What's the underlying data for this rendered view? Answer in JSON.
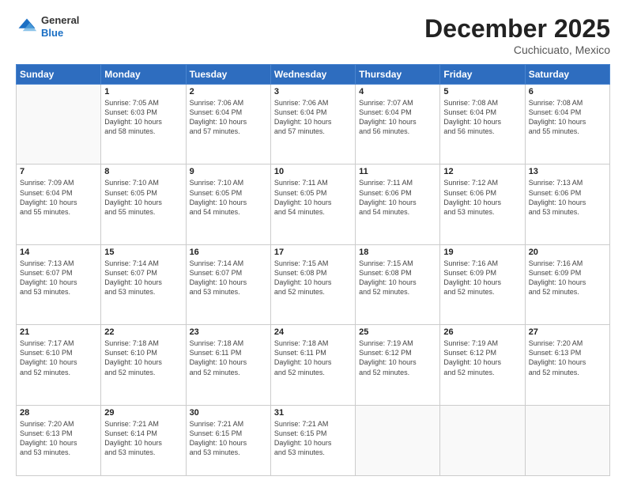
{
  "header": {
    "logo_general": "General",
    "logo_blue": "Blue",
    "month_title": "December 2025",
    "subtitle": "Cuchicuato, Mexico"
  },
  "weekdays": [
    "Sunday",
    "Monday",
    "Tuesday",
    "Wednesday",
    "Thursday",
    "Friday",
    "Saturday"
  ],
  "weeks": [
    [
      {
        "day": "",
        "info": ""
      },
      {
        "day": "1",
        "info": "Sunrise: 7:05 AM\nSunset: 6:03 PM\nDaylight: 10 hours\nand 58 minutes."
      },
      {
        "day": "2",
        "info": "Sunrise: 7:06 AM\nSunset: 6:04 PM\nDaylight: 10 hours\nand 57 minutes."
      },
      {
        "day": "3",
        "info": "Sunrise: 7:06 AM\nSunset: 6:04 PM\nDaylight: 10 hours\nand 57 minutes."
      },
      {
        "day": "4",
        "info": "Sunrise: 7:07 AM\nSunset: 6:04 PM\nDaylight: 10 hours\nand 56 minutes."
      },
      {
        "day": "5",
        "info": "Sunrise: 7:08 AM\nSunset: 6:04 PM\nDaylight: 10 hours\nand 56 minutes."
      },
      {
        "day": "6",
        "info": "Sunrise: 7:08 AM\nSunset: 6:04 PM\nDaylight: 10 hours\nand 55 minutes."
      }
    ],
    [
      {
        "day": "7",
        "info": "Sunrise: 7:09 AM\nSunset: 6:04 PM\nDaylight: 10 hours\nand 55 minutes."
      },
      {
        "day": "8",
        "info": "Sunrise: 7:10 AM\nSunset: 6:05 PM\nDaylight: 10 hours\nand 55 minutes."
      },
      {
        "day": "9",
        "info": "Sunrise: 7:10 AM\nSunset: 6:05 PM\nDaylight: 10 hours\nand 54 minutes."
      },
      {
        "day": "10",
        "info": "Sunrise: 7:11 AM\nSunset: 6:05 PM\nDaylight: 10 hours\nand 54 minutes."
      },
      {
        "day": "11",
        "info": "Sunrise: 7:11 AM\nSunset: 6:06 PM\nDaylight: 10 hours\nand 54 minutes."
      },
      {
        "day": "12",
        "info": "Sunrise: 7:12 AM\nSunset: 6:06 PM\nDaylight: 10 hours\nand 53 minutes."
      },
      {
        "day": "13",
        "info": "Sunrise: 7:13 AM\nSunset: 6:06 PM\nDaylight: 10 hours\nand 53 minutes."
      }
    ],
    [
      {
        "day": "14",
        "info": "Sunrise: 7:13 AM\nSunset: 6:07 PM\nDaylight: 10 hours\nand 53 minutes."
      },
      {
        "day": "15",
        "info": "Sunrise: 7:14 AM\nSunset: 6:07 PM\nDaylight: 10 hours\nand 53 minutes."
      },
      {
        "day": "16",
        "info": "Sunrise: 7:14 AM\nSunset: 6:07 PM\nDaylight: 10 hours\nand 53 minutes."
      },
      {
        "day": "17",
        "info": "Sunrise: 7:15 AM\nSunset: 6:08 PM\nDaylight: 10 hours\nand 52 minutes."
      },
      {
        "day": "18",
        "info": "Sunrise: 7:15 AM\nSunset: 6:08 PM\nDaylight: 10 hours\nand 52 minutes."
      },
      {
        "day": "19",
        "info": "Sunrise: 7:16 AM\nSunset: 6:09 PM\nDaylight: 10 hours\nand 52 minutes."
      },
      {
        "day": "20",
        "info": "Sunrise: 7:16 AM\nSunset: 6:09 PM\nDaylight: 10 hours\nand 52 minutes."
      }
    ],
    [
      {
        "day": "21",
        "info": "Sunrise: 7:17 AM\nSunset: 6:10 PM\nDaylight: 10 hours\nand 52 minutes."
      },
      {
        "day": "22",
        "info": "Sunrise: 7:18 AM\nSunset: 6:10 PM\nDaylight: 10 hours\nand 52 minutes."
      },
      {
        "day": "23",
        "info": "Sunrise: 7:18 AM\nSunset: 6:11 PM\nDaylight: 10 hours\nand 52 minutes."
      },
      {
        "day": "24",
        "info": "Sunrise: 7:18 AM\nSunset: 6:11 PM\nDaylight: 10 hours\nand 52 minutes."
      },
      {
        "day": "25",
        "info": "Sunrise: 7:19 AM\nSunset: 6:12 PM\nDaylight: 10 hours\nand 52 minutes."
      },
      {
        "day": "26",
        "info": "Sunrise: 7:19 AM\nSunset: 6:12 PM\nDaylight: 10 hours\nand 52 minutes."
      },
      {
        "day": "27",
        "info": "Sunrise: 7:20 AM\nSunset: 6:13 PM\nDaylight: 10 hours\nand 52 minutes."
      }
    ],
    [
      {
        "day": "28",
        "info": "Sunrise: 7:20 AM\nSunset: 6:13 PM\nDaylight: 10 hours\nand 53 minutes."
      },
      {
        "day": "29",
        "info": "Sunrise: 7:21 AM\nSunset: 6:14 PM\nDaylight: 10 hours\nand 53 minutes."
      },
      {
        "day": "30",
        "info": "Sunrise: 7:21 AM\nSunset: 6:15 PM\nDaylight: 10 hours\nand 53 minutes."
      },
      {
        "day": "31",
        "info": "Sunrise: 7:21 AM\nSunset: 6:15 PM\nDaylight: 10 hours\nand 53 minutes."
      },
      {
        "day": "",
        "info": ""
      },
      {
        "day": "",
        "info": ""
      },
      {
        "day": "",
        "info": ""
      }
    ]
  ]
}
